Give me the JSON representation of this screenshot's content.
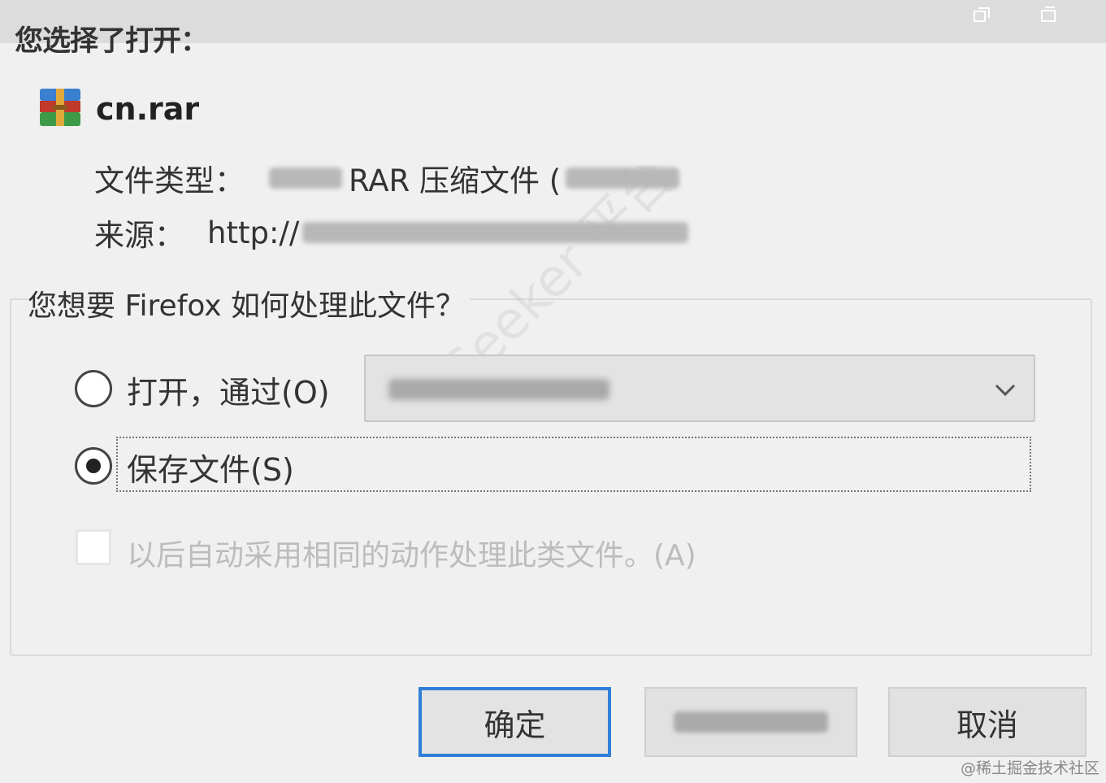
{
  "window": {
    "title": "您选择了打开：",
    "controls": [
      "restore-icon",
      "maximize-icon"
    ]
  },
  "file": {
    "icon": "rar-archive-icon",
    "name": "cn.rar",
    "type_label": "文件类型：",
    "type_value": "RAR 压缩文件 (",
    "source_label": "来源：",
    "source_value": "http://"
  },
  "group": {
    "legend": "您想要 Firefox 如何处理此文件？",
    "option_open": "打开，通过(O)",
    "option_save": "保存文件(S)",
    "selected": "save",
    "remember_label": "以后自动采用相同的动作处理此类文件。(A)",
    "remember_checked": false
  },
  "buttons": {
    "ok": "确定",
    "cancel": "取消"
  },
  "watermark": "Seeker 平台",
  "credit": "@稀土掘金技术社区",
  "colors": {
    "accent": "#2f7fd8",
    "background": "#f0f0f0"
  }
}
